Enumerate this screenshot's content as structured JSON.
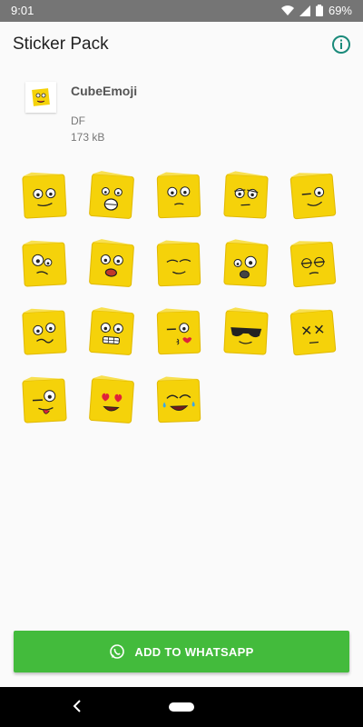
{
  "status_bar": {
    "time": "9:01",
    "battery": "69%"
  },
  "app_bar": {
    "title": "Sticker Pack",
    "info_icon": "info-icon"
  },
  "pack": {
    "name": "CubeEmoji",
    "publisher": "DF",
    "size": "173 kB"
  },
  "stickers": [
    {
      "expr": "smirk"
    },
    {
      "expr": "scream"
    },
    {
      "expr": "neutral"
    },
    {
      "expr": "bored"
    },
    {
      "expr": "wink-squint"
    },
    {
      "expr": "dizzy"
    },
    {
      "expr": "shocked"
    },
    {
      "expr": "sleepy"
    },
    {
      "expr": "worried"
    },
    {
      "expr": "annoyed"
    },
    {
      "expr": "confused"
    },
    {
      "expr": "grimace"
    },
    {
      "expr": "kiss"
    },
    {
      "expr": "sunglasses"
    },
    {
      "expr": "dead"
    },
    {
      "expr": "tongue-wink"
    },
    {
      "expr": "heart-eyes"
    },
    {
      "expr": "tears-of-joy"
    }
  ],
  "actions": {
    "add_label": "ADD TO WHATSAPP"
  },
  "colors": {
    "accent": "#43bb3c",
    "cube": "#f5d20a",
    "info": "#1a8a7a"
  }
}
